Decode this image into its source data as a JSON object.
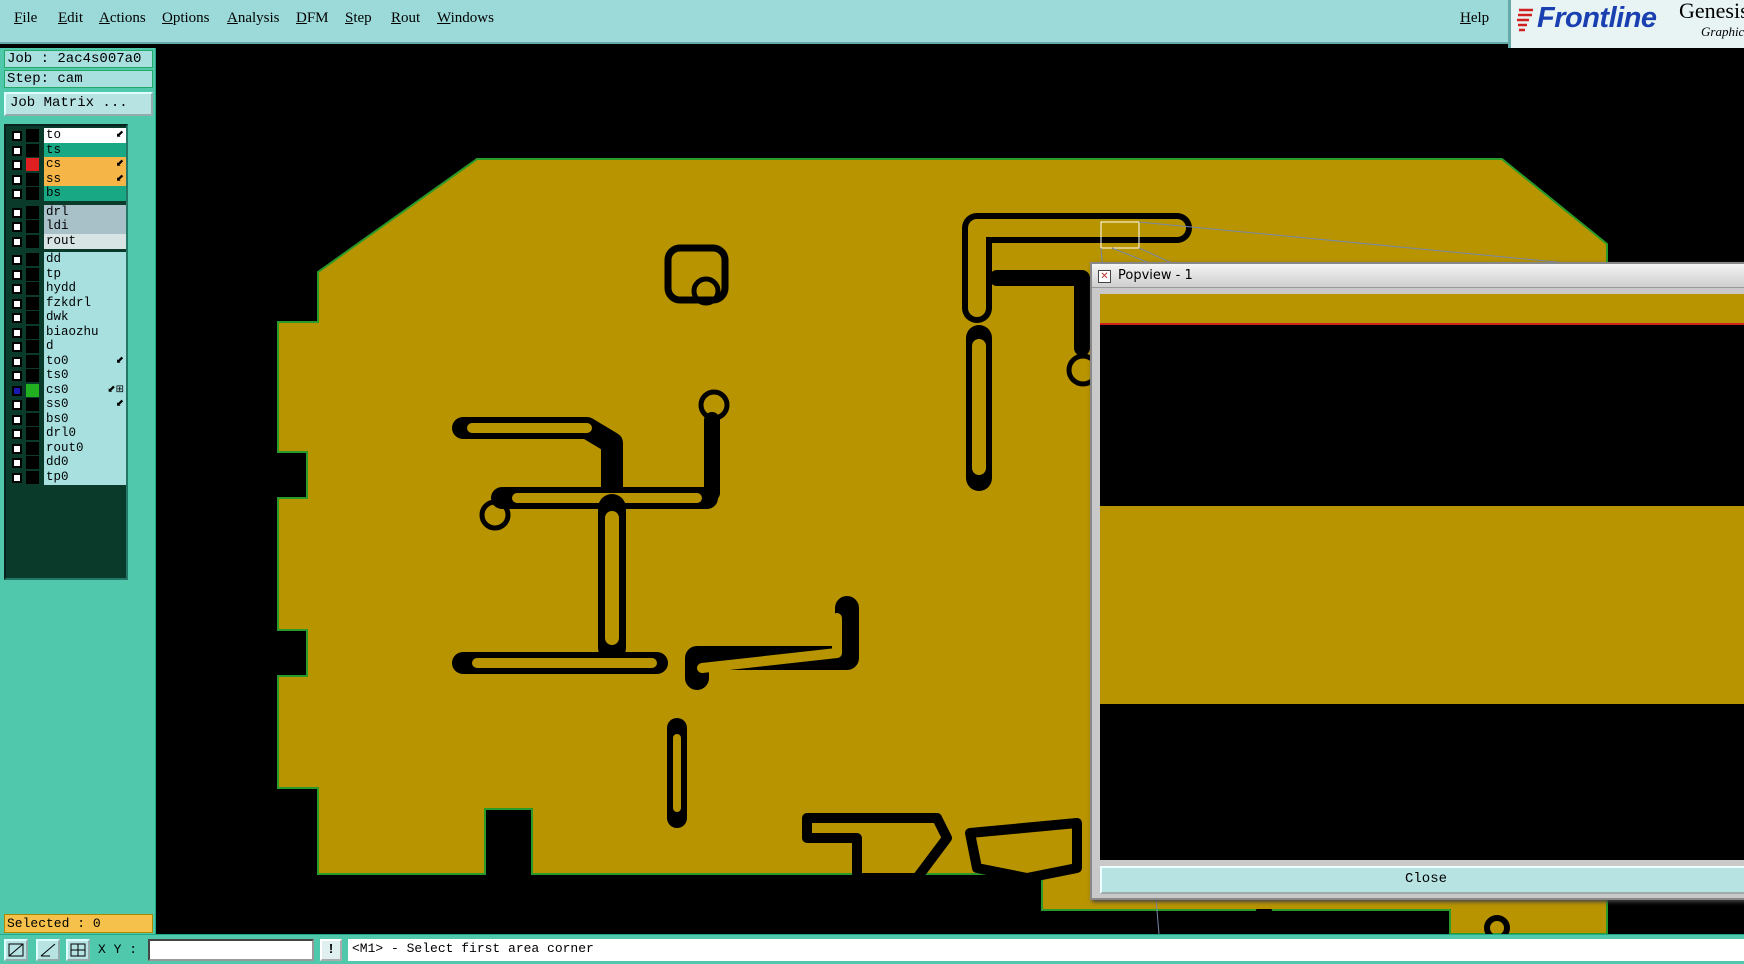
{
  "menubar": {
    "items": [
      "File",
      "Edit",
      "Actions",
      "Options",
      "Analysis",
      "DFM",
      "Step",
      "Rout",
      "Windows"
    ],
    "help": "Help"
  },
  "brand": {
    "name": "Frontline",
    "app": "Genesis",
    "sub": "Graphic"
  },
  "job": {
    "job_label": "Job : 2ac4s007a0",
    "step_label": "Step: cam",
    "matrix_button": "Job Matrix ..."
  },
  "layers": [
    {
      "name": "to",
      "color": "#ffffff",
      "swatch": "#000000",
      "icon": "⬋"
    },
    {
      "name": "ts",
      "color": "#18a884",
      "swatch": "#000000",
      "icon": ""
    },
    {
      "name": "cs",
      "color": "#f5b547",
      "swatch": "#e02020",
      "icon": "⬋"
    },
    {
      "name": "ss",
      "color": "#f5b547",
      "swatch": "#000000",
      "icon": "⬋"
    },
    {
      "name": "bs",
      "color": "#18a884",
      "swatch": "#000000",
      "icon": ""
    },
    {
      "name": "drl",
      "color": "#a8c0c8",
      "swatch": "#000000",
      "icon": ""
    },
    {
      "name": "ldi",
      "color": "#a8c0c8",
      "swatch": "#000000",
      "icon": ""
    },
    {
      "name": "rout",
      "color": "#d8e4e4",
      "swatch": "#000000",
      "icon": ""
    },
    {
      "name": "dd",
      "color": "#a8e0e0",
      "swatch": "#000000",
      "icon": ""
    },
    {
      "name": "tp",
      "color": "#a8e0e0",
      "swatch": "#000000",
      "icon": ""
    },
    {
      "name": "hydd",
      "color": "#a8e0e0",
      "swatch": "#000000",
      "icon": ""
    },
    {
      "name": "fzkdrl",
      "color": "#a8e0e0",
      "swatch": "#000000",
      "icon": ""
    },
    {
      "name": "dwk",
      "color": "#a8e0e0",
      "swatch": "#000000",
      "icon": ""
    },
    {
      "name": "biaozhu",
      "color": "#a8e0e0",
      "swatch": "#000000",
      "icon": ""
    },
    {
      "name": "d",
      "color": "#a8e0e0",
      "swatch": "#000000",
      "icon": ""
    },
    {
      "name": "to0",
      "color": "#a8e0e0",
      "swatch": "#000000",
      "icon": "⬋"
    },
    {
      "name": "ts0",
      "color": "#a8e0e0",
      "swatch": "#000000",
      "icon": ""
    },
    {
      "name": "cs0",
      "color": "#a8e0e0",
      "swatch": "#20b020",
      "icon": "⬋⊞",
      "active": true
    },
    {
      "name": "ss0",
      "color": "#a8e0e0",
      "swatch": "#000000",
      "icon": "⬋"
    },
    {
      "name": "bs0",
      "color": "#a8e0e0",
      "swatch": "#000000",
      "icon": ""
    },
    {
      "name": "drl0",
      "color": "#a8e0e0",
      "swatch": "#000000",
      "icon": ""
    },
    {
      "name": "rout0",
      "color": "#a8e0e0",
      "swatch": "#000000",
      "icon": ""
    },
    {
      "name": "dd0",
      "color": "#a8e0e0",
      "swatch": "#000000",
      "icon": ""
    },
    {
      "name": "tp0",
      "color": "#a8e0e0",
      "swatch": "#000000",
      "icon": ""
    }
  ],
  "selected_label": "Selected : 0",
  "popview": {
    "title": "Popview - 1",
    "close_label": "Close"
  },
  "statusbar": {
    "xy_label": "X Y :",
    "xy_value": "",
    "prompt": "<M1> - Select first area corner"
  },
  "colors": {
    "board": "#b89400",
    "board_outline": "#2a9a2a",
    "panel": "#4fc8ab",
    "menubar": "#9cdada"
  }
}
